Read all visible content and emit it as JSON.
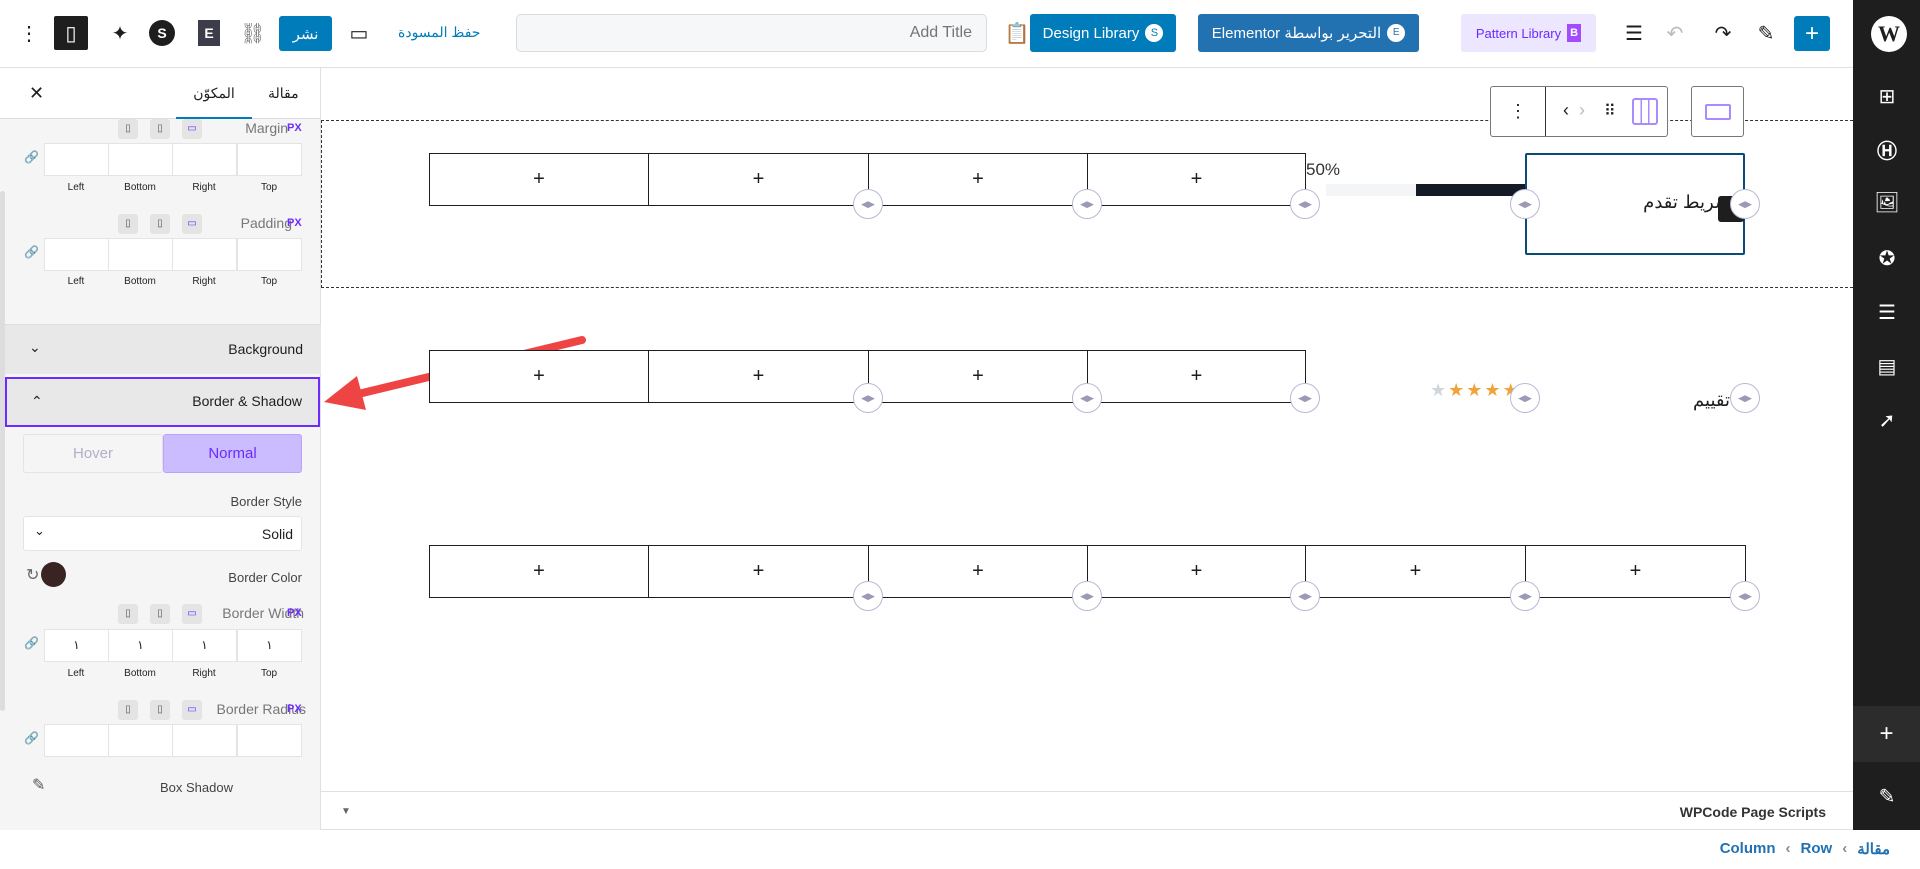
{
  "topbar": {
    "more": "⋮",
    "publish": "نشر",
    "save_draft": "حفظ المسودة",
    "title_placeholder": "Add Title",
    "design_library": "Design Library",
    "edit_elementor": "Elementor التحرير بواسطة",
    "pattern_library": "Pattern Library",
    "add": "+"
  },
  "panel": {
    "tabs": [
      "مقالة",
      "المكوّن"
    ],
    "close": "✕",
    "margin": {
      "label": "Margin",
      "unit": "PX",
      "sides": [
        "Left",
        "Bottom",
        "Right",
        "Top"
      ],
      "values": [
        "",
        "",
        "",
        ""
      ]
    },
    "padding": {
      "label": "Padding",
      "unit": "PX",
      "sides": [
        "Left",
        "Bottom",
        "Right",
        "Top"
      ],
      "values": [
        "",
        "",
        "",
        ""
      ]
    },
    "background": "Background",
    "border_shadow": "Border & Shadow",
    "state_tabs": {
      "hover": "Hover",
      "normal": "Normal"
    },
    "border_style": {
      "label": "Border Style",
      "value": "Solid"
    },
    "border_color": {
      "label": "Border Color",
      "color": "#3a2323"
    },
    "border_width": {
      "label": "Border Width",
      "unit": "PX",
      "sides": [
        "Left",
        "Bottom",
        "Right",
        "Top"
      ],
      "values": [
        "١",
        "١",
        "١",
        "١"
      ]
    },
    "border_radius": {
      "label": "Border Radius",
      "unit": "PX",
      "values": [
        "",
        "",
        "",
        ""
      ]
    },
    "box_shadow": "Box Shadow"
  },
  "canvas": {
    "add": "+",
    "progress": {
      "label": "شريط تقدم",
      "percent_text": "50%",
      "value": 50
    },
    "rating": {
      "label": "تقييم",
      "stars": 4,
      "max": 5
    }
  },
  "footer": {
    "wpcode": "WPCode Page Scripts",
    "breadcrumb": [
      "مقالة",
      "Row",
      "Column"
    ]
  }
}
